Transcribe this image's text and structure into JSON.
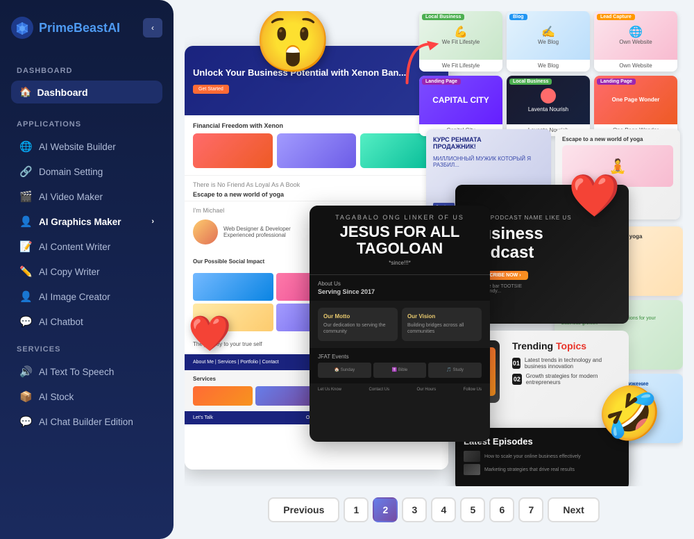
{
  "app": {
    "name": "PrimeBeast",
    "name_highlight": "AI",
    "tagline": "PrimeBeast AI"
  },
  "sidebar": {
    "dashboard_label": "DASHBOARD",
    "dashboard_active": "Dashboard",
    "applications_label": "APPLICATIONS",
    "services_label": "SERVICES",
    "nav_items": [
      {
        "id": "website-builder",
        "label": "AI Website Builder",
        "icon": "🌐"
      },
      {
        "id": "domain-setting",
        "label": "Domain Setting",
        "icon": "🔗"
      },
      {
        "id": "video-maker",
        "label": "AI Video Maker",
        "icon": "🎬"
      },
      {
        "id": "graphics-maker",
        "label": "AI Graphics Maker",
        "icon": "👤",
        "arrow": "›"
      },
      {
        "id": "content-writer",
        "label": "AI Content Writer",
        "icon": "📝"
      },
      {
        "id": "copy-writer",
        "label": "AI Copy Writer",
        "icon": "✏️"
      },
      {
        "id": "image-creator",
        "label": "AI Image Creator",
        "icon": "👤"
      },
      {
        "id": "chatbot",
        "label": "AI Chatbot",
        "icon": "💬"
      }
    ],
    "service_items": [
      {
        "id": "text-to-speech",
        "label": "AI Text To Speech",
        "icon": "🔊"
      },
      {
        "id": "stock",
        "label": "AI Stock",
        "icon": "📦"
      },
      {
        "id": "chat-builder",
        "label": "AI Chat Builder Edition",
        "icon": "💬"
      }
    ]
  },
  "gallery": {
    "thumbnails_top": [
      {
        "id": "t1",
        "label": "We Fit Lifestyle",
        "tag": "Local Business",
        "tag_color": "#4caf50"
      },
      {
        "id": "t2",
        "label": "We Blog",
        "tag": "Blog",
        "tag_color": "#2196f3"
      },
      {
        "id": "t3",
        "label": "Own Website",
        "tag": "Lead Capture",
        "tag_color": "#ff9800"
      },
      {
        "id": "t4",
        "label": "Capital City",
        "tag": "Landing Page",
        "tag_color": "#9c27b0"
      },
      {
        "id": "t5",
        "label": "Laventa Nourish",
        "tag": "Local Business",
        "tag_color": "#4caf50"
      },
      {
        "id": "t6",
        "label": "One Page Wonder",
        "tag": "Landing Page",
        "tag_color": "#9c27b0"
      }
    ],
    "featured_card": {
      "subtitle": "TAGABALO ONG LINKER OF US",
      "title": "JESUS FOR ALL TAGOLOAN",
      "tagline": "*since!!!*",
      "since": "Serving Since 2017",
      "our_motto": "Our Motto",
      "our_vision": "Our Vision"
    },
    "podcast_card": {
      "subtitle": "SOME PODCAST NAME LIKE US",
      "title": "Business Podcast",
      "cta": "SUBSCRIBE NOW"
    },
    "trending_card": {
      "title": "Trending Topics",
      "items": [
        "01",
        "02"
      ]
    },
    "episodes_card": {
      "title": "Latest Episodes"
    }
  },
  "pagination": {
    "prev_label": "Previous",
    "next_label": "Next",
    "pages": [
      "1",
      "2",
      "3",
      "4",
      "5",
      "6",
      "7"
    ],
    "active_page": "2"
  }
}
